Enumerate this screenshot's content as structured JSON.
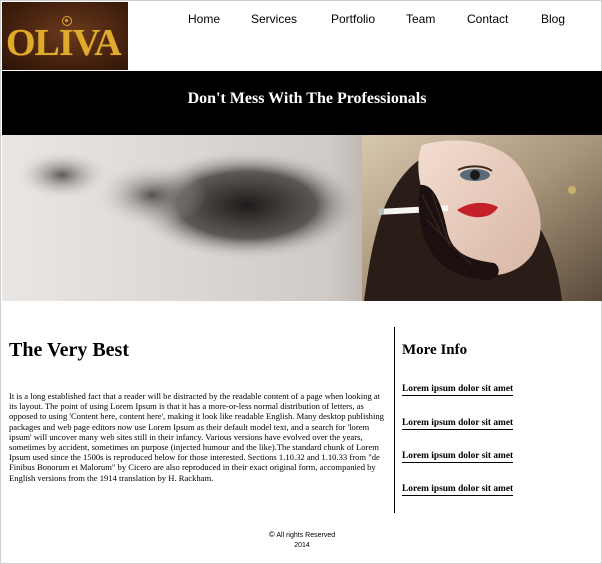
{
  "logo": {
    "text": "OLIVA"
  },
  "nav": {
    "items": [
      {
        "label": "Home"
      },
      {
        "label": "Services"
      },
      {
        "label": "Portfolio"
      },
      {
        "label": "Team"
      },
      {
        "label": "Contact"
      },
      {
        "label": "Blog"
      }
    ]
  },
  "banner": {
    "title": "Don't Mess With The Professionals"
  },
  "hero": {
    "image_icon": "woman-smoking-cigar-photo"
  },
  "main": {
    "title": "The Very Best",
    "body": "It is a long established fact that a reader will be distracted by the readable content of a page when looking at its layout. The point of using Lorem Ipsum is that it has a more-or-less normal distribution of letters, as opposed to using 'Content here, content here', making it look like readable English. Many desktop publishing packages and web page editors now use Lorem Ipsum as their default model text, and a search for 'lorem ipsum' will uncover many web sites still in their infancy. Various versions have evolved over the years, sometimes by accident, sometimes on purpose (injected humour and the like).The standard chunk of Lorem Ipsum used since the 1500s is reproduced below for those interested. Sections 1.10.32 and 1.10.33 from \"de Finibus Bonorum et Malorum\" by Cicero are also reproduced in their exact original form, accompanied by English versions from the 1914 translation by H. Rackham."
  },
  "sidebar": {
    "title": "More Info",
    "links": [
      {
        "label": "Lorem ipsum dolor sit amet"
      },
      {
        "label": "Lorem ipsum dolor sit amet"
      },
      {
        "label": "Lorem ipsum dolor sit amet"
      },
      {
        "label": "Lorem ipsum dolor sit amet"
      }
    ]
  },
  "footer": {
    "copyright_symbol": "©",
    "rights": "All rights Reserved",
    "year": "2014"
  },
  "colors": {
    "banner_bg": "#000000",
    "logo_gold": "#e0ab2c",
    "logo_bg": "#4a2410"
  }
}
